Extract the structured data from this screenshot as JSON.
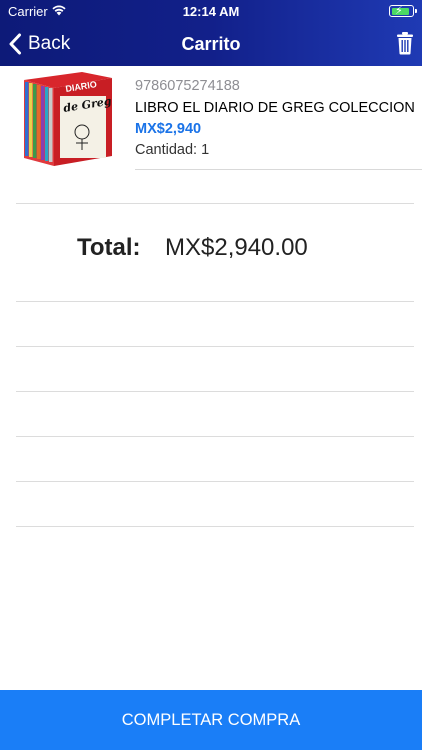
{
  "status_bar": {
    "carrier": "Carrier",
    "time": "12:14 AM"
  },
  "nav": {
    "back_label": "Back",
    "title": "Carrito"
  },
  "cart_item": {
    "sku": "9786075274188",
    "name": "LIBRO EL DIARIO DE GREG COLECCION",
    "price": "MX$2,940",
    "quantity": "Cantidad: 1",
    "cover_text": "DIARIO de Greg"
  },
  "summary": {
    "total_label": "Total:",
    "total_value": "MX$2,940.00"
  },
  "actions": {
    "checkout_label": "COMPLETAR COMPRA"
  },
  "colors": {
    "header_start": "#0d1a78",
    "header_end": "#1f3ab4",
    "price": "#1a73e8",
    "checkout": "#1a7ef7"
  },
  "icons": [
    "wifi-icon",
    "battery-icon",
    "back-chevron-icon",
    "trash-icon"
  ]
}
